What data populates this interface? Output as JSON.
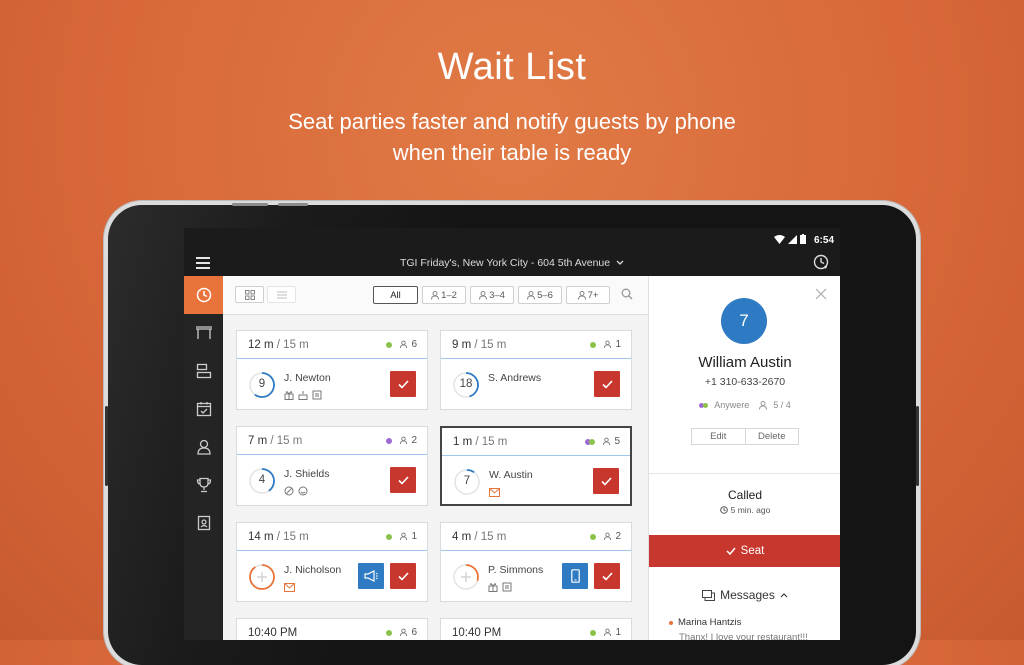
{
  "promo": {
    "title": "Wait List",
    "subtitle_line1": "Seat parties faster and notify guests by phone",
    "subtitle_line2": "when their table is ready"
  },
  "status_bar": {
    "time": "6:54"
  },
  "topbar": {
    "restaurant": "TGI Friday's, New York City - 604 5th Avenue"
  },
  "nav": {
    "items": [
      {
        "name": "wait-list",
        "icon": "clock-icon",
        "active": true
      },
      {
        "name": "tables",
        "icon": "table-icon",
        "active": false
      },
      {
        "name": "floor-plan",
        "icon": "layout-icon",
        "active": false
      },
      {
        "name": "reservations",
        "icon": "calendar-check-icon",
        "active": false
      },
      {
        "name": "guests",
        "icon": "person-icon",
        "active": false
      },
      {
        "name": "rewards",
        "icon": "trophy-icon",
        "active": false
      },
      {
        "name": "contacts",
        "icon": "contact-card-icon",
        "active": false
      }
    ]
  },
  "filters": {
    "all": "All",
    "f1": "1–2",
    "f2": "3–4",
    "f3": "5–6",
    "f4": "7+"
  },
  "cards": [
    {
      "wait": "12 m",
      "quoted": "15 m",
      "dot_color": "#8bc34a",
      "party": "6",
      "ring": "9",
      "name": "J. Newton",
      "icons": [
        "gift-icon",
        "cake-icon",
        "note-icon"
      ],
      "progress": 0.6,
      "ring_color": "#2e7bc4"
    },
    {
      "wait": "9 m",
      "quoted": "15 m",
      "dot_color": "#8bc34a",
      "party": "1",
      "ring": "18",
      "name": "S. Andrews",
      "icons": [],
      "progress": 0.45,
      "ring_color": "#2e7bc4"
    },
    {
      "wait": "7 m",
      "quoted": "15 m",
      "dot_color": "#9c6bd1",
      "party": "2",
      "ring": "4",
      "name": "J. Shields",
      "icons": [
        "no-icon",
        "smile-icon"
      ],
      "progress": 0.4,
      "ring_color": "#2e7bc4"
    },
    {
      "wait": "1 m",
      "quoted": "15 m",
      "dot_color": "#9c6bd1",
      "dot_color2": "#8bc34a",
      "party": "5",
      "ring": "7",
      "name": "W. Austin",
      "icons": [
        "mail-icon"
      ],
      "progress": 0.1,
      "ring_color": "#2e7bc4",
      "selected": true
    },
    {
      "wait": "14 m",
      "quoted": "15 m",
      "dot_color": "#8bc34a",
      "party": "1",
      "ring": "+",
      "name": "J. Nicholson",
      "icons": [
        "mail-icon"
      ],
      "progress": 0.9,
      "ring_color": "#e8743b",
      "notify": "megaphone-icon"
    },
    {
      "wait": "4 m",
      "quoted": "15 m",
      "dot_color": "#8bc34a",
      "party": "2",
      "ring": "+",
      "name": "P. Simmons",
      "icons": [
        "gift-icon",
        "note-icon"
      ],
      "progress": 0.3,
      "ring_color": "#e8743b",
      "notify": "phone-icon"
    },
    {
      "wait": "10:40 PM",
      "quoted": "",
      "dot_color": "#8bc34a",
      "party": "6"
    },
    {
      "wait": "10:40 PM",
      "quoted": "",
      "dot_color": "#8bc34a",
      "party": "1"
    }
  ],
  "detail": {
    "party_number": "7",
    "name": "William Austin",
    "phone": "+1 310-633-2670",
    "seating": "Anywere",
    "party": "5 / 4",
    "edit": "Edit",
    "delete": "Delete",
    "status": "Called",
    "status_time": "5 min. ago",
    "seat_label": "Seat",
    "messages_label": "Messages",
    "message_author": "Marina Hantzis",
    "message_text": "Thanx! I love your restaurant!!!"
  },
  "colors": {
    "accent": "#e8743b",
    "seat": "#c8372d",
    "blue": "#2e7bc4"
  }
}
